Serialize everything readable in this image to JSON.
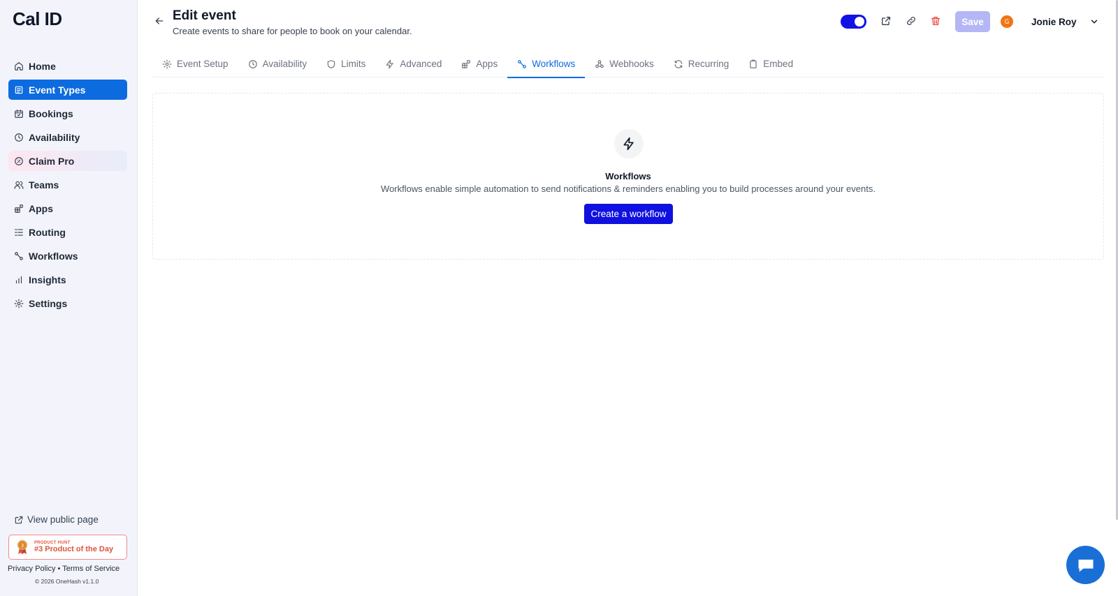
{
  "app": {
    "logo": "Cal ID"
  },
  "sidebar": {
    "items": [
      {
        "label": "Home",
        "icon": "home-icon"
      },
      {
        "label": "Event Types",
        "icon": "event-types-icon",
        "active": true
      },
      {
        "label": "Bookings",
        "icon": "calendar-icon"
      },
      {
        "label": "Availability",
        "icon": "clock-icon"
      },
      {
        "label": "Claim Pro",
        "icon": "claim-pro-icon"
      },
      {
        "label": "Teams",
        "icon": "users-icon"
      },
      {
        "label": "Apps",
        "icon": "apps-icon"
      },
      {
        "label": "Routing",
        "icon": "routing-icon"
      },
      {
        "label": "Workflows",
        "icon": "workflow-icon"
      },
      {
        "label": "Insights",
        "icon": "chart-icon"
      },
      {
        "label": "Settings",
        "icon": "gear-icon"
      }
    ],
    "view_public": "View public page",
    "badge": {
      "small": "PRODUCT HUNT",
      "big": "#3 Product of the Day",
      "medal_number": "3"
    },
    "footer": {
      "privacy": "Privacy Policy",
      "separator": "•",
      "terms": "Terms of Service",
      "copyright": "© 2026 OneHash v1.1.0"
    }
  },
  "header": {
    "title": "Edit event",
    "subtitle": "Create events to share for people to book on your calendar.",
    "save_label": "Save",
    "user": {
      "initial": "G",
      "name": "Jonie Roy"
    }
  },
  "tabs": [
    {
      "label": "Event Setup",
      "icon": "gear-icon"
    },
    {
      "label": "Availability",
      "icon": "clock-icon"
    },
    {
      "label": "Limits",
      "icon": "shield-icon"
    },
    {
      "label": "Advanced",
      "icon": "bolt-icon"
    },
    {
      "label": "Apps",
      "icon": "apps-icon"
    },
    {
      "label": "Workflows",
      "icon": "workflow-icon",
      "active": true
    },
    {
      "label": "Webhooks",
      "icon": "webhook-icon"
    },
    {
      "label": "Recurring",
      "icon": "refresh-icon"
    },
    {
      "label": "Embed",
      "icon": "clipboard-icon"
    }
  ],
  "empty_state": {
    "title": "Workflows",
    "description": "Workflows enable simple automation to send notifications & reminders enabling you to build processes around your events.",
    "button": "Create a workflow"
  },
  "colors": {
    "accent": "#0d6be0",
    "primary_button": "#1010e0",
    "toggle_on": "#1212e6",
    "save_disabled": "#b4b6f6",
    "delete": "#ef4444",
    "avatar": "#f07515"
  }
}
